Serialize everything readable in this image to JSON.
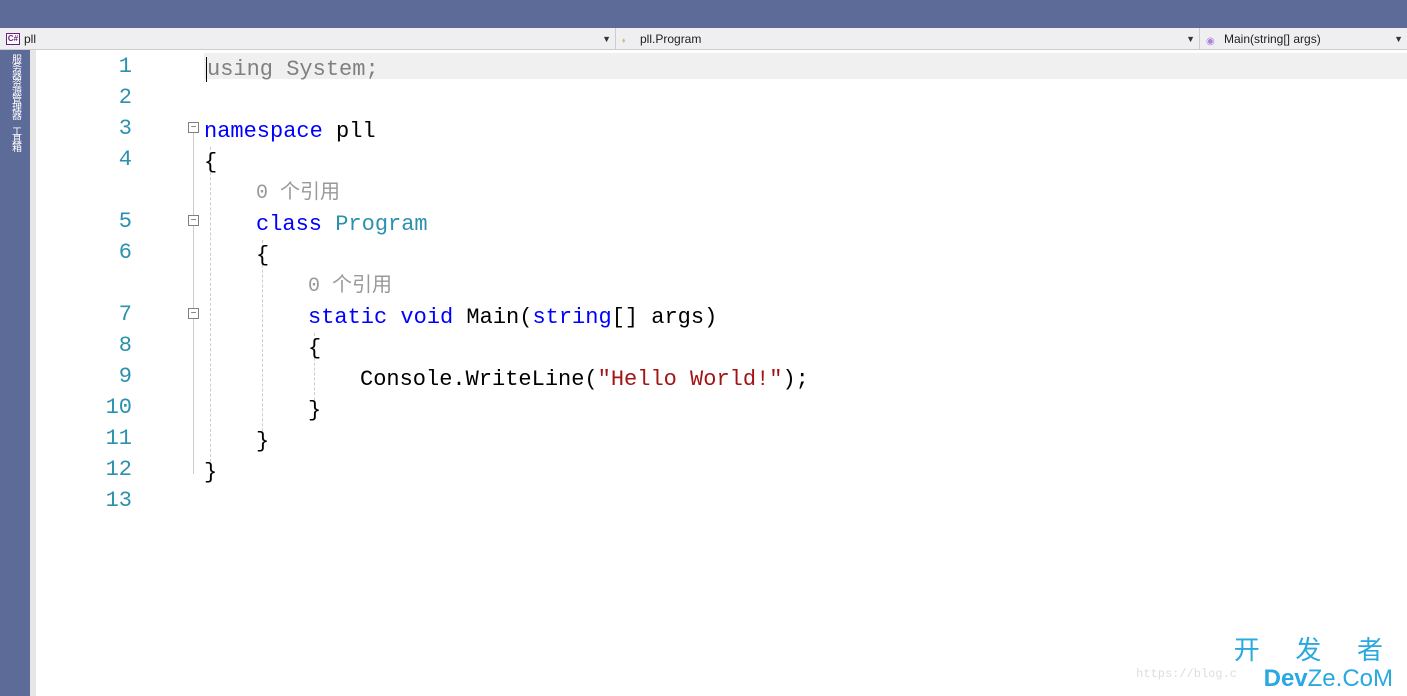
{
  "nav": {
    "project": "pll",
    "class": "pll.Program",
    "method": "Main(string[] args)"
  },
  "sidetabs": [
    "服务器资源管理器",
    "工具箱"
  ],
  "lines": {
    "n1": "1",
    "n2": "2",
    "n3": "3",
    "n4": "4",
    "n5": "5",
    "n6": "6",
    "n7": "7",
    "n8": "8",
    "n9": "9",
    "n10": "10",
    "n11": "11",
    "n12": "12",
    "n13": "13"
  },
  "code": {
    "using": "using",
    "system": "System",
    "semicolon": ";",
    "namespace": "namespace",
    "ns_name": " pll",
    "lbrace": "{",
    "rbrace": "}",
    "codelens": "0 个引用",
    "class_kw": "class",
    "class_name": " Program",
    "static": "static",
    "void": " void",
    "main": " Main",
    "lp": "(",
    "string_kw": "string",
    "arr": "[] args",
    "rp": ")",
    "console": "Console.WriteLine(",
    "hello": "\"Hello World!\"",
    "tail": ");"
  },
  "fold": {
    "minus": "−"
  },
  "watermark": {
    "cn": "开 发 者",
    "en1": "Dev",
    "en2": "Ze.CoM",
    "faint": "https://blog.c"
  }
}
